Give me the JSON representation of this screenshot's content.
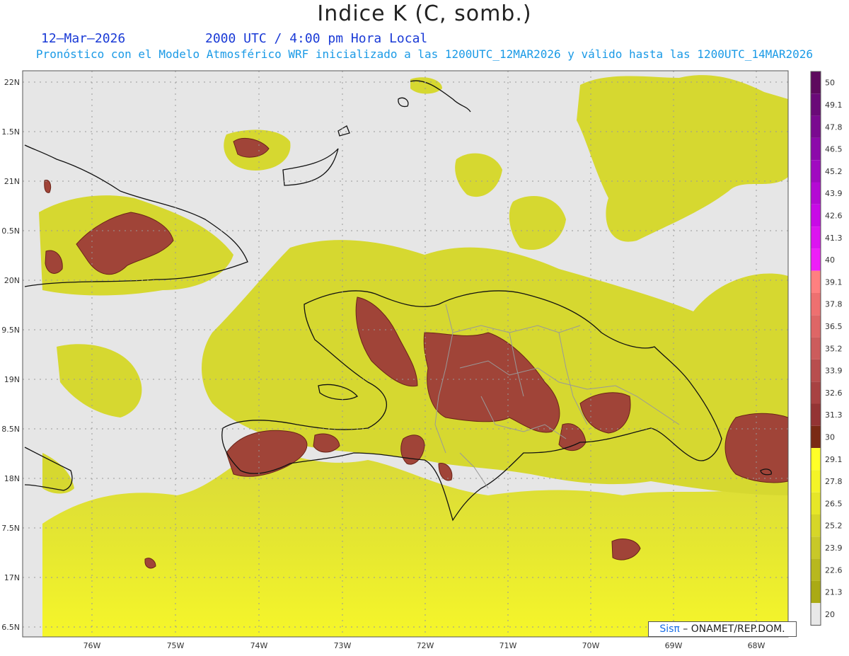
{
  "title": "Indice K (C, somb.)",
  "date": "12–Mar–2026",
  "time": "2000 UTC / 4:00 pm Hora Local",
  "subtitle": "Pronóstico con el Modelo Atmosférico WRF inicializado a las 1200UTC_12MAR2026 y válido hasta las  1200UTC_14MAR2026",
  "lat_labels": [
    "22N",
    "1.5N",
    "21N",
    "0.5N",
    "20N",
    "9.5N",
    "19N",
    "8.5N",
    "18N",
    "7.5N",
    "17N",
    "6.5N"
  ],
  "lon_labels": [
    "76W",
    "75W",
    "74W",
    "73W",
    "72W",
    "71W",
    "70W",
    "69W",
    "68W"
  ],
  "colorbar": {
    "labels": [
      "50",
      "49.1",
      "47.8",
      "46.5",
      "45.2",
      "43.9",
      "42.6",
      "41.3",
      "40",
      "39.1",
      "37.8",
      "36.5",
      "35.2",
      "33.9",
      "32.6",
      "31.3",
      "30",
      "29.1",
      "27.8",
      "26.5",
      "25.2",
      "23.9",
      "22.6",
      "21.3",
      "20"
    ],
    "colors": [
      "#5e0a5e",
      "#6a0a78",
      "#7a0a90",
      "#8c0aaa",
      "#a00ac0",
      "#b40ad4",
      "#c80ae6",
      "#dc14f0",
      "#ee1ef8",
      "#ff8080",
      "#ee7070",
      "#de6666",
      "#cc5c5c",
      "#b84e4e",
      "#a84242",
      "#943434",
      "#7a2a14",
      "#ffff28",
      "#f4f428",
      "#e6e628",
      "#d6d628",
      "#c8c828",
      "#b8b81e",
      "#aaaa14",
      "#e8e8e8"
    ]
  },
  "colors": {
    "land_fill": "#d8d830",
    "high_fill": "#a04438",
    "background": "#e6e6e6"
  },
  "credit": {
    "brand": "Sisπ",
    "text": " – ONAMET/REP.DOM."
  }
}
